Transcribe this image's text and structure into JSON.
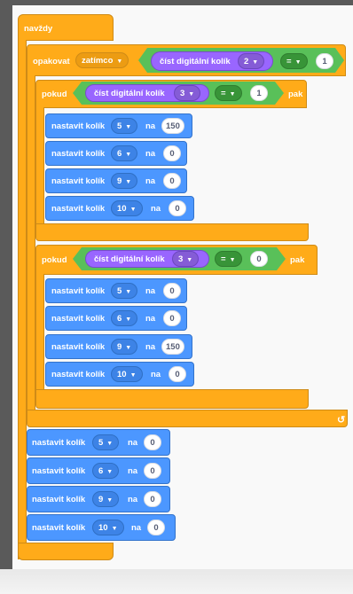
{
  "forever": {
    "label": "navždy"
  },
  "repeat": {
    "label": "opakovat",
    "mode": "zatímco",
    "read_label": "číst digitální kolík",
    "pin": "2",
    "op": "=",
    "value": "1"
  },
  "if1": {
    "label": "pokud",
    "read_label": "číst digitální kolík",
    "pin": "3",
    "op": "=",
    "value": "1",
    "then": "pak",
    "sets": [
      {
        "label": "nastavit kolík",
        "pin": "5",
        "na": "na",
        "value": "150"
      },
      {
        "label": "nastavit kolík",
        "pin": "6",
        "na": "na",
        "value": "0"
      },
      {
        "label": "nastavit kolík",
        "pin": "9",
        "na": "na",
        "value": "0"
      },
      {
        "label": "nastavit kolík",
        "pin": "10",
        "na": "na",
        "value": "0"
      }
    ]
  },
  "if2": {
    "label": "pokud",
    "read_label": "číst digitální kolík",
    "pin": "3",
    "op": "=",
    "value": "0",
    "then": "pak",
    "sets": [
      {
        "label": "nastavit kolík",
        "pin": "5",
        "na": "na",
        "value": "0"
      },
      {
        "label": "nastavit kolík",
        "pin": "6",
        "na": "na",
        "value": "0"
      },
      {
        "label": "nastavit kolík",
        "pin": "9",
        "na": "na",
        "value": "150"
      },
      {
        "label": "nastavit kolík",
        "pin": "10",
        "na": "na",
        "value": "0"
      }
    ]
  },
  "after": [
    {
      "label": "nastavit kolík",
      "pin": "5",
      "na": "na",
      "value": "0"
    },
    {
      "label": "nastavit kolík",
      "pin": "6",
      "na": "na",
      "value": "0"
    },
    {
      "label": "nastavit kolík",
      "pin": "9",
      "na": "na",
      "value": "0"
    },
    {
      "label": "nastavit kolík",
      "pin": "10",
      "na": "na",
      "value": "0"
    }
  ],
  "icons": {
    "dropdown": "chevron-down-icon",
    "loop": "loop-arrow-icon"
  },
  "colors": {
    "control": "#ffab19",
    "operator": "#59c059",
    "sensing": "#9966ff",
    "pin": "#4c97ff"
  }
}
